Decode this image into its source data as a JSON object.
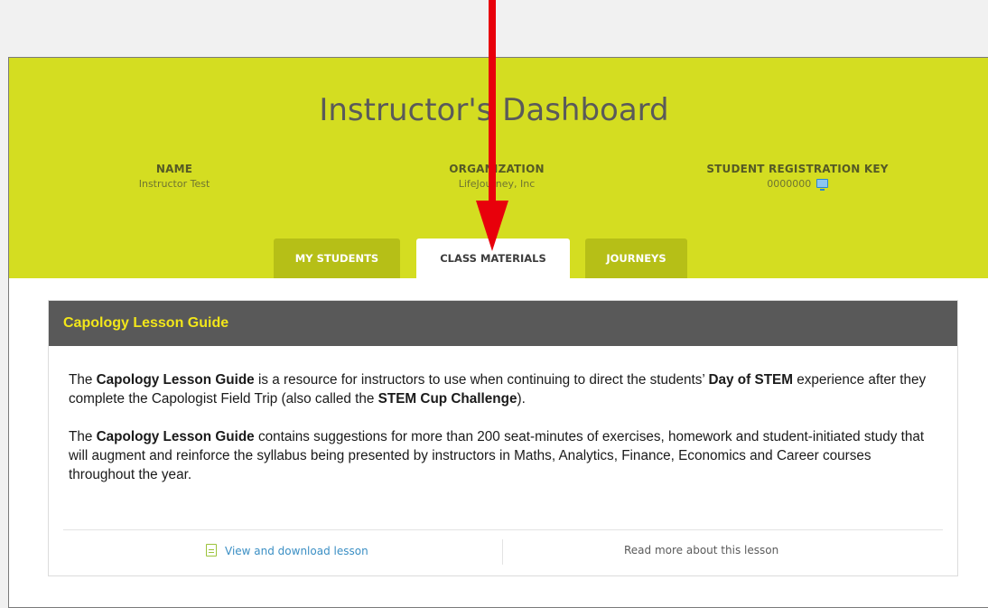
{
  "dashboard": {
    "title": "Instructor's Dashboard"
  },
  "info": {
    "name_label": "NAME",
    "name_value": "Instructor Test",
    "org_label": "ORGANIZATION",
    "org_value": "LifeJourney, Inc",
    "key_label": "STUDENT REGISTRATION KEY",
    "key_value": "0000000",
    "key_icon": "screen-icon"
  },
  "tabs": [
    {
      "label": "MY STUDENTS",
      "active": false
    },
    {
      "label": "CLASS MATERIALS",
      "active": true
    },
    {
      "label": "JOURNEYS",
      "active": false
    }
  ],
  "card": {
    "title": "Capology Lesson Guide",
    "p1": {
      "t1": "The ",
      "b1": "Capology Lesson Guide",
      "t2": " is a resource for instructors to use when continuing to direct the students’ ",
      "b2": "Day of STEM",
      "t3": " experience after they complete the Capologist Field Trip (also called the ",
      "b3": "STEM Cup Challenge",
      "t4": ")."
    },
    "p2": {
      "t1": "The ",
      "b1": "Capology Lesson Guide",
      "t2": " contains suggestions for more than 200 seat-minutes of exercises, homework and student-initiated study that will augment and reinforce the syllabus being presented by instructors in Maths, Analytics, Finance, Economics and Career courses throughout the year."
    },
    "view_link": "View and download lesson",
    "read_link": "Read more about this lesson"
  },
  "colors": {
    "header_bg": "#d4dd21",
    "tab_inactive": "#b6bf17",
    "card_header": "#595959",
    "card_title": "#f2e61a",
    "link_blue": "#3b8fc4",
    "annotation_arrow": "#e8000b"
  }
}
